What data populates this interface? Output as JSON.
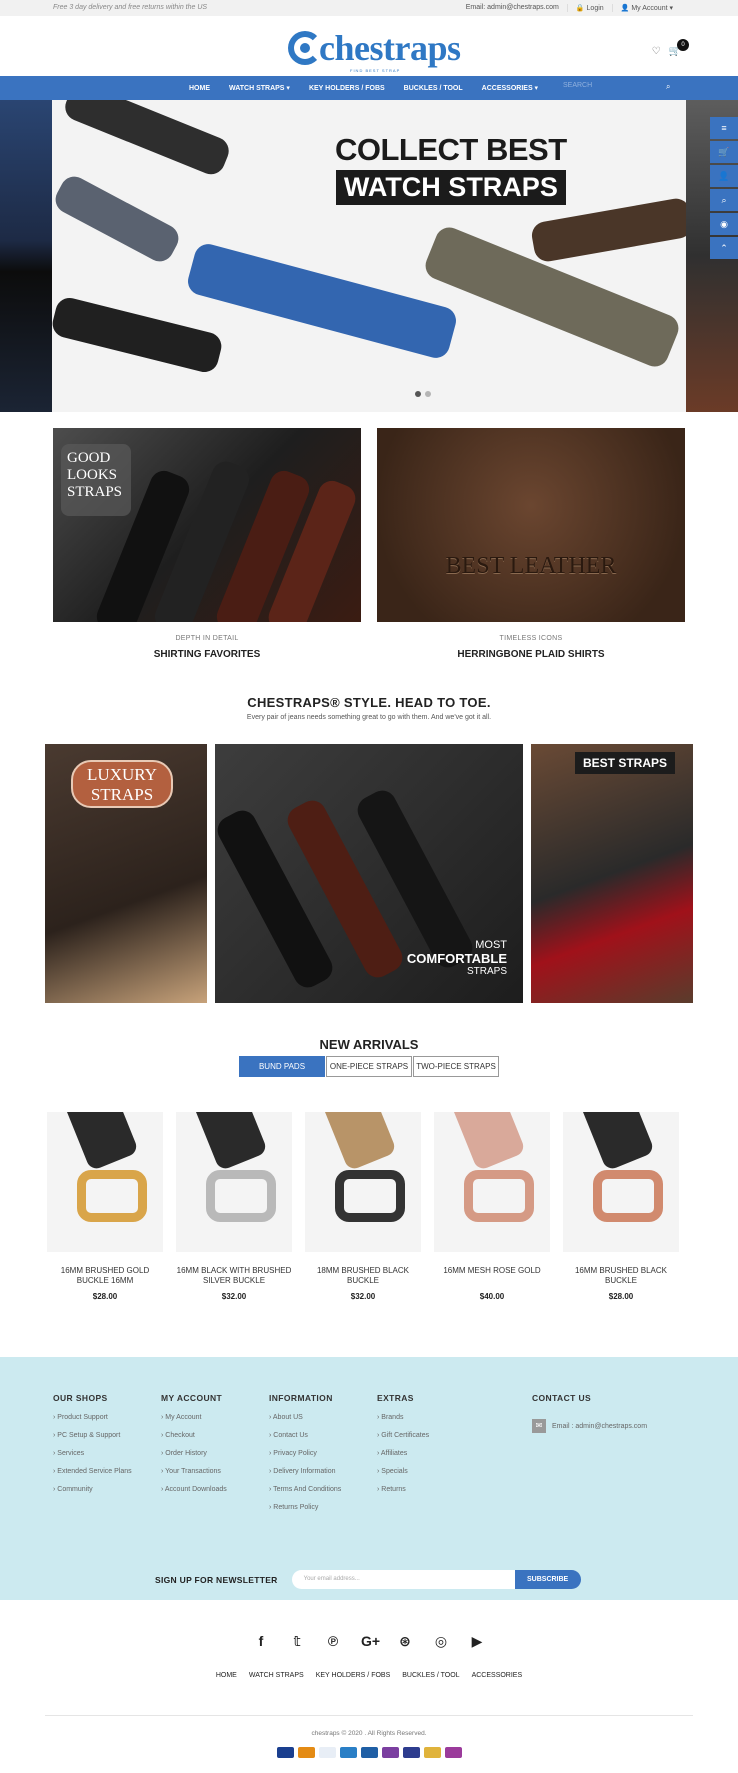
{
  "topbar": {
    "promo": "Free 3 day delivery and free returns within the US",
    "email": "Email: admin@chestraps.com",
    "login": "Login",
    "account": "My Account"
  },
  "header": {
    "logo_text": "chestraps",
    "logo_tagline": "FIND BEST STRAP",
    "cart_count": "0"
  },
  "nav": {
    "items": [
      "HOME",
      "WATCH STRAPS ▾",
      "KEY HOLDERS / FOBS",
      "BUCKLES / TOOL",
      "ACCESSORIES ▾"
    ],
    "search_placeholder": "SEARCH"
  },
  "banner": {
    "line1": "COLLECT BEST",
    "line2": "WATCH STRAPS"
  },
  "promos": [
    {
      "overlay": "GOOD LOOKS STRAPS",
      "sub": "DEPTH IN DETAIL",
      "title": "SHIRTING FAVORITES"
    },
    {
      "overlay": "BEST LEATHER",
      "sub": "TIMELESS ICONS",
      "title": "HERRINGBONE PLAID SHIRTS"
    }
  ],
  "style_section": {
    "title": "CHESTRAPS® STYLE. HEAD TO TOE.",
    "subtitle": "Every pair of jeans needs something great to go with them. And we've got it all.",
    "luxury": "LUXURY STRAPS",
    "comfort_1": "MOST",
    "comfort_2": "COMFORTABLE",
    "comfort_3": "STRAPS",
    "best": "BEST STRAPS"
  },
  "arrivals": {
    "title": "NEW ARRIVALS",
    "tabs": [
      "BUND PADS",
      "ONE-PIECE STRAPS",
      "TWO-PIECE STRAPS"
    ],
    "products": [
      {
        "name": "16MM BRUSHED GOLD BUCKLE 16MM",
        "price": "$28.00",
        "strap": "#2a2a2a",
        "buckle": "#d9a54a"
      },
      {
        "name": "16MM BLACK WITH BRUSHED SILVER BUCKLE",
        "price": "$32.00",
        "strap": "#2a2a2a",
        "buckle": "#b9b9b9"
      },
      {
        "name": "18MM BRUSHED BLACK BUCKLE",
        "price": "$32.00",
        "strap": "#b89468",
        "buckle": "#333333"
      },
      {
        "name": "16MM MESH ROSE GOLD",
        "price": "$40.00",
        "strap": "#d9a99a",
        "buckle": "#d59a85"
      },
      {
        "name": "16MM BRUSHED BLACK BUCKLE",
        "price": "$28.00",
        "strap": "#2a2a2a",
        "buckle": "#d18a6e"
      }
    ]
  },
  "footer": {
    "columns": [
      {
        "title": "OUR SHOPS",
        "links": [
          "Product Support",
          "PC Setup & Support",
          "Services",
          "Extended Service Plans",
          "Community"
        ]
      },
      {
        "title": "MY ACCOUNT",
        "links": [
          "My Account",
          "Checkout",
          "Order History",
          "Your Transactions",
          "Account Downloads"
        ]
      },
      {
        "title": "INFORMATION",
        "links": [
          "About US",
          "Contact Us",
          "Privacy Policy",
          "Delivery Information",
          "Terms And Conditions",
          "Returns Policy"
        ]
      },
      {
        "title": "EXTRAS",
        "links": [
          "Brands",
          "Gift Certificates",
          "Affiliates",
          "Specials",
          "Returns"
        ]
      }
    ],
    "contact_title": "CONTACT US",
    "contact_email": "Email : admin@chestraps.com",
    "newsletter_label": "SIGN UP FOR NEWSLETTER",
    "newsletter_placeholder": "Your email address...",
    "subscribe": "SUBSCRIBE",
    "nav": [
      "HOME",
      "WATCH STRAPS",
      "KEY HOLDERS / FOBS",
      "BUCKLES / TOOL",
      "ACCESSORIES"
    ],
    "copyright": "chestraps © 2020 . All Rights Reserved."
  },
  "colors": {
    "brand_blue": "#3a73c0",
    "footer_bg": "#cceaf0"
  }
}
